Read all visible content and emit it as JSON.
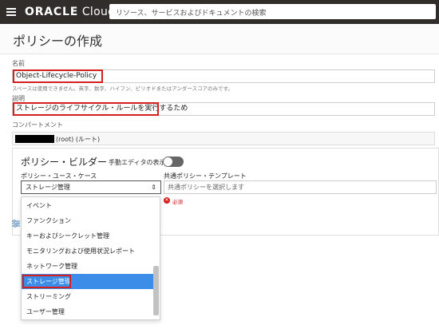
{
  "header": {
    "brand_oracle": "ORACLE",
    "brand_cloud": "Cloud",
    "search_placeholder": "リソース、サービスおよびドキュメントの検索"
  },
  "page": {
    "title": "ポリシーの作成"
  },
  "form": {
    "name_label": "名前",
    "name_value": "Object-Lifecycle-Policy",
    "name_hint": "スペースは使用できません。英字、数字、ハイフン、ピリオドまたはアンダースコアのみです。",
    "description_label": "説明",
    "description_value": "ストレージのライフサイクル・ルールを実行するため",
    "compartment_label": "コンパートメント",
    "compartment_value": "(root) (ルート)"
  },
  "builder": {
    "title": "ポリシー・ビルダー",
    "manual_editor_label": "手動エディタの表示",
    "use_case_label": "ポリシー・ユース・ケース",
    "use_case_selected": "ストレージ管理",
    "template_label": "共通ポリシー・テンプレート",
    "template_placeholder": "共通ポリシーを選択します",
    "required_text": "必須"
  },
  "dropdown": {
    "items": [
      "イベント",
      "ファンクション",
      "キーおよびシークレット管理",
      "モニタリングおよび使用状況レポート",
      "ネットワーク管理",
      "ストレージ管理",
      "ストリーミング",
      "ユーザー管理"
    ],
    "selected_index": 5
  },
  "colors": {
    "topbar": "#312d2a",
    "highlight": "#d61f1f",
    "selection": "#3b8de8"
  }
}
